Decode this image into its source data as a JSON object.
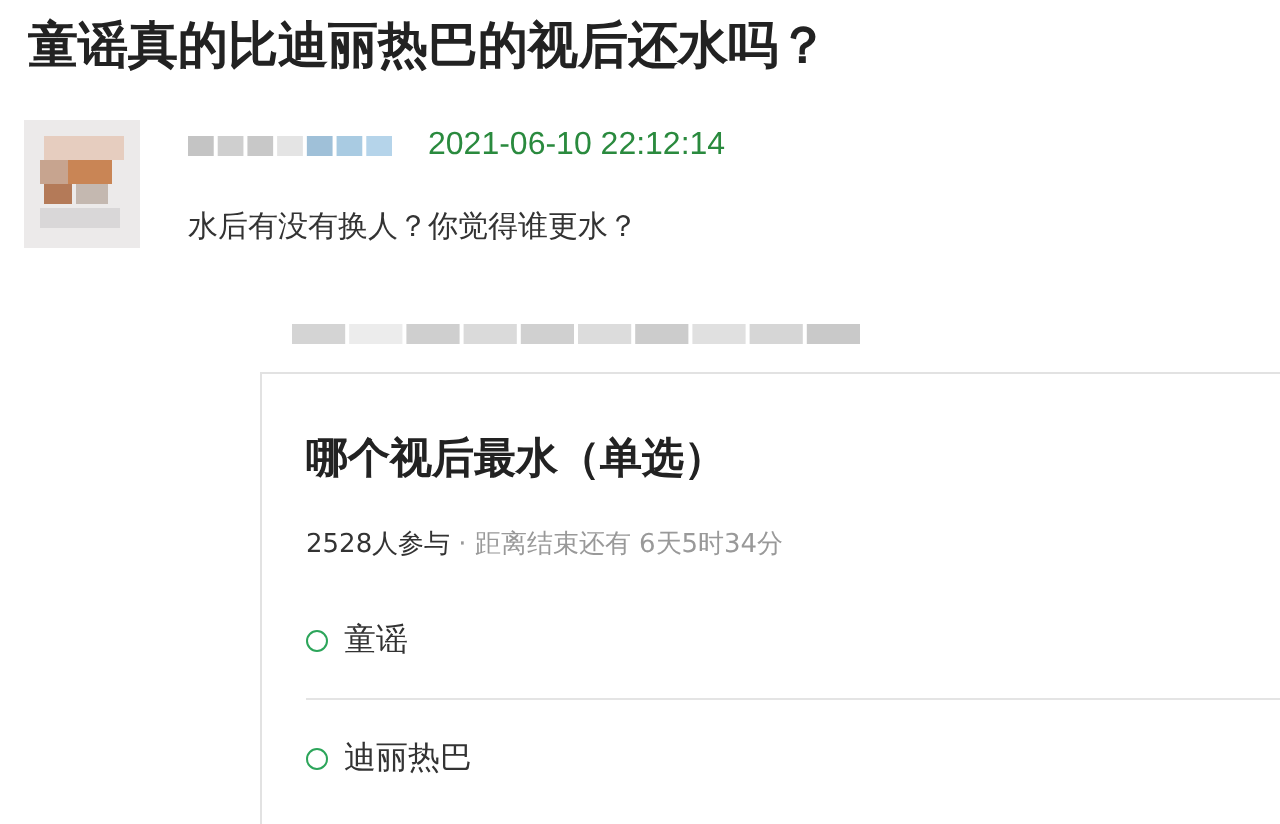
{
  "title": "童谣真的比迪丽热巴的视后还水吗？",
  "post": {
    "timestamp": "2021-06-10 22:12:14",
    "body": "水后有没有换人？你觉得谁更水？"
  },
  "poll": {
    "title": "哪个视后最水（单选）",
    "participants": "2528人参与",
    "remaining": "· 距离结束还有 6天5时34分",
    "options": [
      {
        "label": "童谣",
        "selected": false
      },
      {
        "label": "迪丽热巴",
        "selected": false
      }
    ]
  }
}
